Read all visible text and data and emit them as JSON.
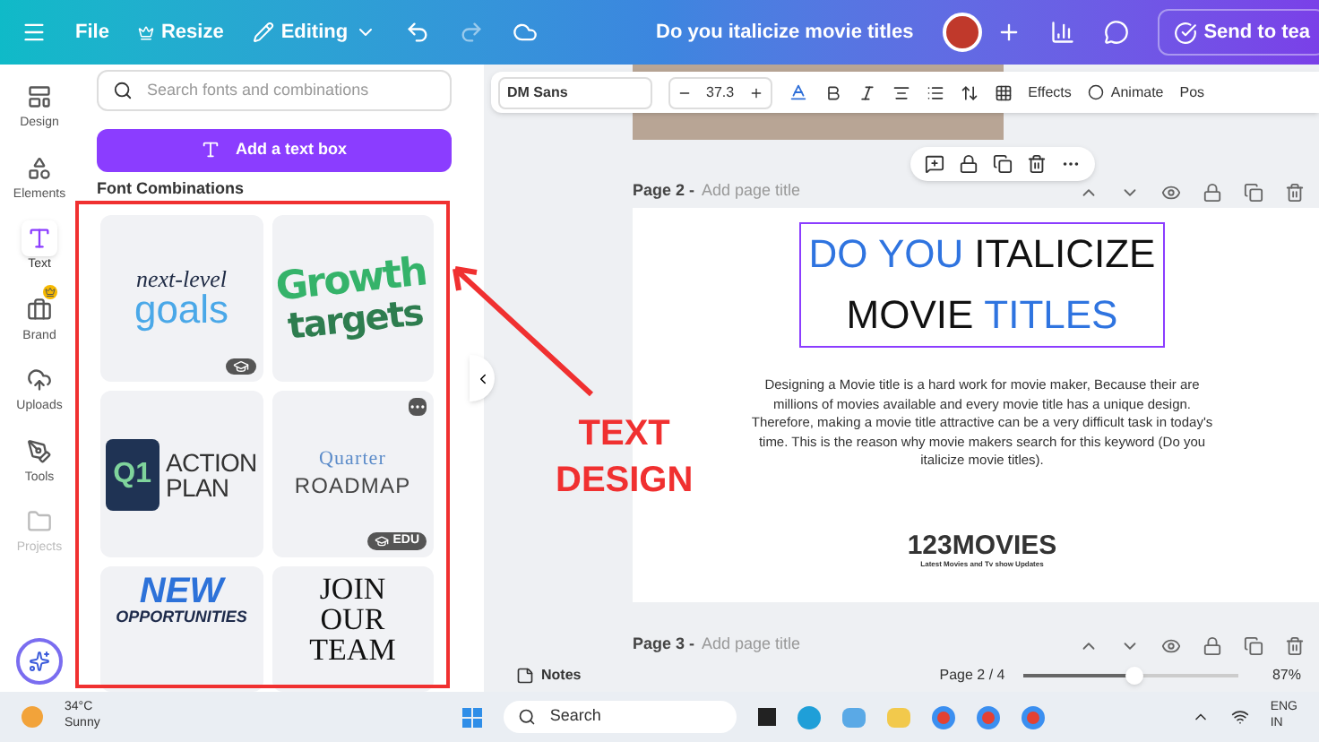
{
  "topbar": {
    "menu": [
      "File",
      "Resize",
      "Editing"
    ],
    "title": "Do you italicize movie titles",
    "share": "Send to tea"
  },
  "rail": [
    {
      "label": "Design",
      "selected": false,
      "crown": false
    },
    {
      "label": "Elements",
      "selected": false,
      "crown": false
    },
    {
      "label": "Text",
      "selected": true,
      "crown": false
    },
    {
      "label": "Brand",
      "selected": false,
      "crown": true
    },
    {
      "label": "Uploads",
      "selected": false,
      "crown": false
    },
    {
      "label": "Tools",
      "selected": false,
      "crown": false
    },
    {
      "label": "Projects",
      "selected": false,
      "crown": false
    }
  ],
  "panel": {
    "search": {
      "placeholder": "Search fonts and combinations"
    },
    "add_button": "Add a text box",
    "section": "Font Combinations",
    "cards": [
      {
        "kind": "script",
        "lines": [
          "next-level",
          "goals"
        ],
        "cap_badge": true,
        "menu": false
      },
      {
        "kind": "bold",
        "lines": [
          "Growth",
          "targets"
        ],
        "cap_badge": false,
        "menu": false
      },
      {
        "kind": "tile",
        "lines": [
          "Q1",
          "ACTION",
          "PLAN"
        ],
        "cap_badge": false,
        "menu": false
      },
      {
        "kind": "serif",
        "lines": [
          "Quarter",
          "ROADMAP"
        ],
        "cap_badge": true,
        "badge_text": "EDU",
        "menu": true
      },
      {
        "kind": "slanted",
        "lines": [
          "NEW",
          "OPPORTUNITIES"
        ],
        "cap_badge": false,
        "menu": false
      },
      {
        "kind": "tall",
        "lines": [
          "JOIN",
          "OUR",
          "TEAM"
        ],
        "cap_badge": false,
        "menu": false
      }
    ]
  },
  "text_toolbar": {
    "font": "DM Sans",
    "size": "37.3",
    "buttons": [
      "Effects",
      "Animate",
      "Pos"
    ]
  },
  "pages": [
    {
      "label": "Page 2 -",
      "title_placeholder": "Add page title"
    },
    {
      "label": "Page 3 -",
      "title_placeholder": "Add page title"
    }
  ],
  "design": {
    "heading_lines": [
      [
        {
          "text": "DO YOU",
          "highlight": true
        },
        {
          "text": "ITALICIZE",
          "highlight": false
        }
      ],
      [
        {
          "text": "MOVIE",
          "highlight": false
        },
        {
          "text": "TITLES",
          "highlight": true
        }
      ]
    ],
    "paragraph": "Designing a Movie title is a hard work for movie maker, Because their are millions of movies available and every movie title has a unique design. Therefore, making a movie title attractive can be a very difficult task in today's time. This is the reason why movie makers search for this keyword (Do you italicize movie titles).",
    "logo": "123MOVIES",
    "tagline": "Latest Movies and Tv show Updates"
  },
  "footer": {
    "notes": "Notes",
    "page": "Page 2 / 4",
    "zoom": {
      "level": 0.52
    },
    "zoom_reading": "87%"
  },
  "annotation": {
    "lines": [
      "TEXT",
      "DESIGN"
    ]
  },
  "taskbar": {
    "temp": "34°C",
    "weather": "Sunny",
    "search": "Search",
    "lang": [
      "ENG",
      "IN"
    ]
  }
}
